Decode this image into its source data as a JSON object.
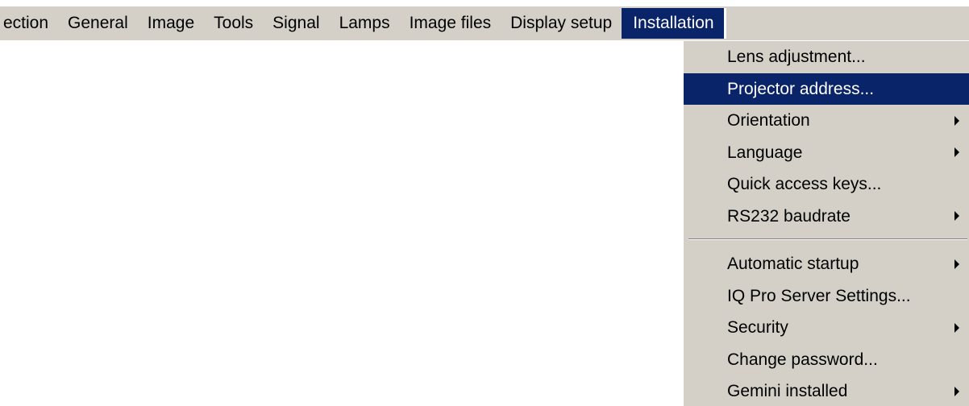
{
  "menubar": {
    "items": [
      {
        "label": "ection"
      },
      {
        "label": "General"
      },
      {
        "label": "Image"
      },
      {
        "label": "Tools"
      },
      {
        "label": "Signal"
      },
      {
        "label": "Lamps"
      },
      {
        "label": "Image files"
      },
      {
        "label": "Display setup"
      },
      {
        "label": "Installation",
        "active": true
      }
    ]
  },
  "installation_menu": {
    "items": [
      {
        "label": "Lens adjustment...",
        "submenu": false
      },
      {
        "label": "Projector address...",
        "submenu": false,
        "highlighted": true
      },
      {
        "label": "Orientation",
        "submenu": true
      },
      {
        "label": "Language",
        "submenu": true
      },
      {
        "label": "Quick access keys...",
        "submenu": false
      },
      {
        "label": "RS232 baudrate",
        "submenu": true
      },
      {
        "label": "Automatic startup",
        "submenu": true
      },
      {
        "label": "IQ Pro Server Settings...",
        "submenu": false
      },
      {
        "label": "Security",
        "submenu": true
      },
      {
        "label": "Change password...",
        "submenu": false
      },
      {
        "label": "Gemini installed",
        "submenu": true
      }
    ]
  },
  "colors": {
    "menu_background": "#d4d0c8",
    "highlight": "#0a246a",
    "highlight_text": "#ffffff"
  },
  "icons": {
    "submenu_indicator": "triangle-right-icon"
  }
}
